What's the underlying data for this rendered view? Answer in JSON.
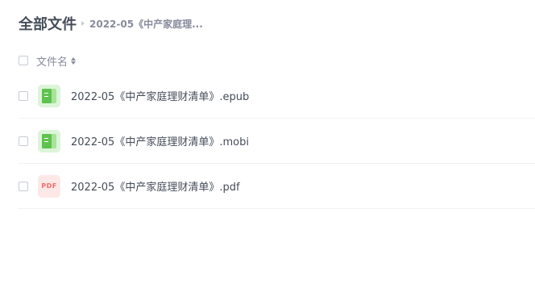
{
  "breadcrumb": {
    "root_label": "全部文件",
    "current_label": "2022-05《中产家庭理..."
  },
  "list_header": {
    "name_column_label": "文件名",
    "sort_icon": "sort-icon"
  },
  "files": [
    {
      "name": "2022-05《中产家庭理财清单》.epub",
      "icon": "ebook-icon"
    },
    {
      "name": "2022-05《中产家庭理财清单》.mobi",
      "icon": "ebook-icon"
    },
    {
      "name": "2022-05《中产家庭理财清单》.pdf",
      "icon": "pdf-icon",
      "icon_text": "PDF"
    }
  ],
  "colors": {
    "text_primary": "#454d5a",
    "text_secondary": "#878c9c",
    "ebook_green": "#5fc24e",
    "pdf_red": "#f36b6b"
  }
}
